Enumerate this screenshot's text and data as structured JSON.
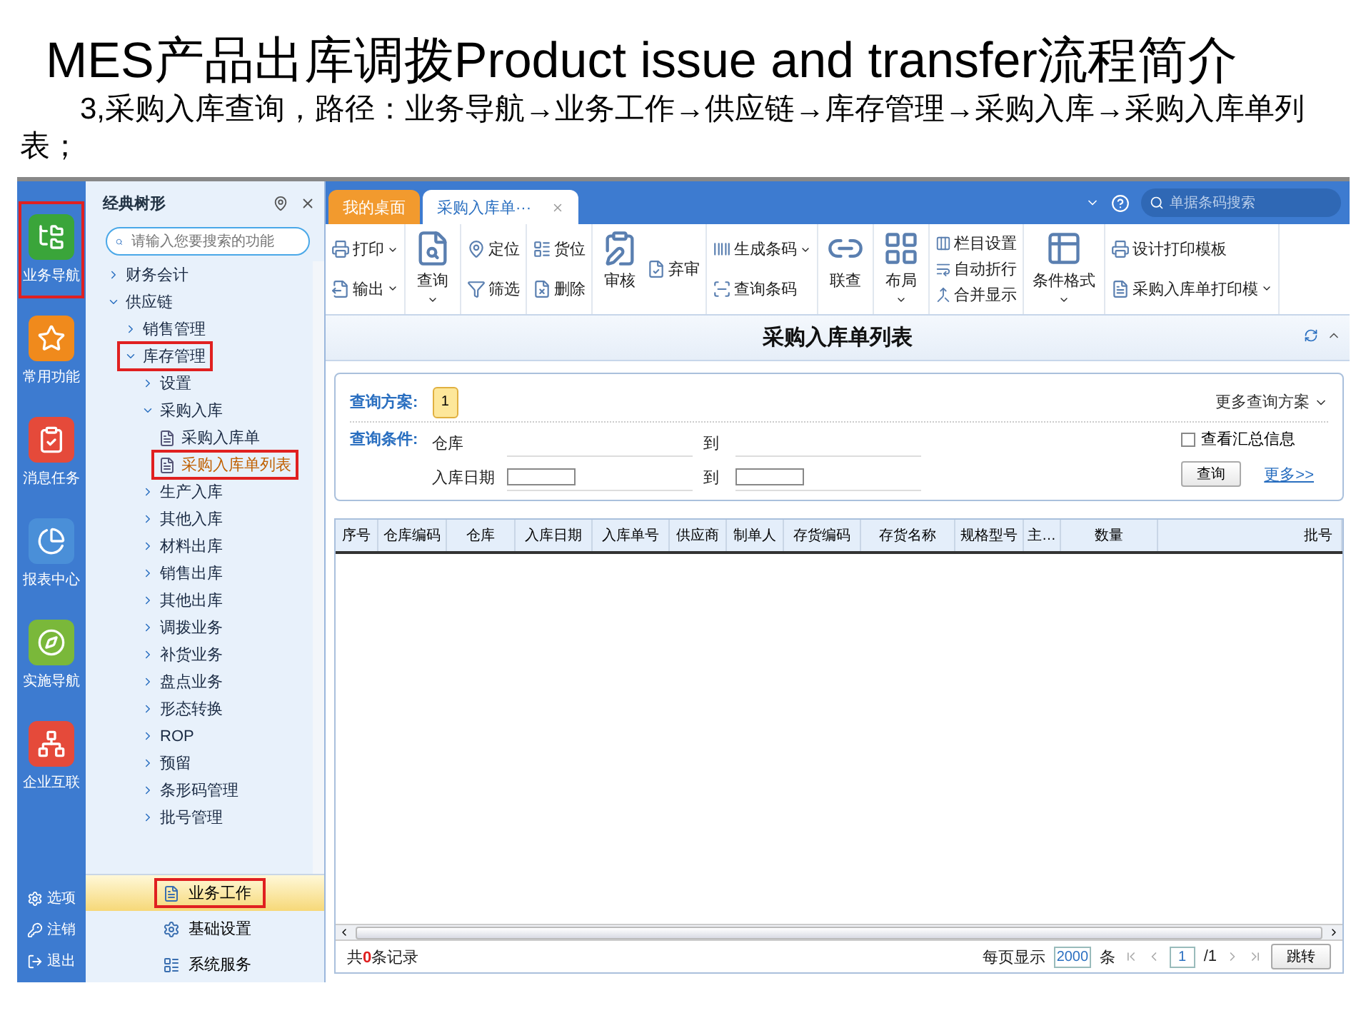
{
  "title": "MES产品出库调拨Product issue and transfer流程简介",
  "subtitle": "3,采购入库查询，路径：业务导航→业务工作→供应链→库存管理→采购入库→采购入库单列表；",
  "rail": {
    "items": [
      {
        "label": "业务导航",
        "kind": "nav",
        "highlighted": true
      },
      {
        "label": "常用功能",
        "kind": "star",
        "highlighted": false
      },
      {
        "label": "消息任务",
        "kind": "task",
        "highlighted": false
      },
      {
        "label": "报表中心",
        "kind": "report",
        "highlighted": false
      },
      {
        "label": "实施导航",
        "kind": "guide",
        "highlighted": false
      },
      {
        "label": "企业互联",
        "kind": "link",
        "highlighted": false
      }
    ],
    "bottom": [
      {
        "label": "选项",
        "kind": "gear"
      },
      {
        "label": "注销",
        "kind": "key"
      },
      {
        "label": "退出",
        "kind": "exit"
      }
    ]
  },
  "tree_panel": {
    "title": "经典树形",
    "search": {
      "placeholder": "请输入您要搜索的功能"
    },
    "tree": [
      {
        "label": "财务会计",
        "kind": "folder",
        "expanded": false,
        "highlighted": false,
        "selected": false
      },
      {
        "label": "供应链",
        "kind": "folder",
        "expanded": true,
        "highlighted": false,
        "selected": false,
        "children": [
          {
            "label": "销售管理",
            "kind": "folder",
            "expanded": false,
            "highlighted": false,
            "selected": false
          },
          {
            "label": "库存管理",
            "kind": "folder",
            "expanded": true,
            "highlighted": true,
            "selected": false,
            "children": [
              {
                "label": "设置",
                "kind": "folder",
                "expanded": false,
                "highlighted": false,
                "selected": false
              },
              {
                "label": "采购入库",
                "kind": "folder",
                "expanded": true,
                "highlighted": false,
                "selected": false,
                "children": [
                  {
                    "label": "采购入库单",
                    "kind": "doc",
                    "highlighted": false,
                    "selected": false
                  },
                  {
                    "label": "采购入库单列表",
                    "kind": "doc",
                    "highlighted": true,
                    "selected": true
                  }
                ]
              },
              {
                "label": "生产入库",
                "kind": "folder",
                "expanded": false,
                "highlighted": false,
                "selected": false
              },
              {
                "label": "其他入库",
                "kind": "folder",
                "expanded": false,
                "highlighted": false,
                "selected": false
              },
              {
                "label": "材料出库",
                "kind": "folder",
                "expanded": false,
                "highlighted": false,
                "selected": false
              },
              {
                "label": "销售出库",
                "kind": "folder",
                "expanded": false,
                "highlighted": false,
                "selected": false
              },
              {
                "label": "其他出库",
                "kind": "folder",
                "expanded": false,
                "highlighted": false,
                "selected": false
              },
              {
                "label": "调拨业务",
                "kind": "folder",
                "expanded": false,
                "highlighted": false,
                "selected": false
              },
              {
                "label": "补货业务",
                "kind": "folder",
                "expanded": false,
                "highlighted": false,
                "selected": false
              },
              {
                "label": "盘点业务",
                "kind": "folder",
                "expanded": false,
                "highlighted": false,
                "selected": false
              },
              {
                "label": "形态转换",
                "kind": "folder",
                "expanded": false,
                "highlighted": false,
                "selected": false
              },
              {
                "label": "ROP",
                "kind": "folder",
                "expanded": false,
                "highlighted": false,
                "selected": false
              },
              {
                "label": "预留",
                "kind": "folder",
                "expanded": false,
                "highlighted": false,
                "selected": false
              },
              {
                "label": "条形码管理",
                "kind": "folder",
                "expanded": false,
                "highlighted": false,
                "selected": false
              },
              {
                "label": "批号管理",
                "kind": "folder",
                "expanded": false,
                "highlighted": false,
                "selected": false
              }
            ]
          }
        ]
      }
    ],
    "sections": [
      {
        "label": "业务工作",
        "selected": true,
        "highlighted": true
      },
      {
        "label": "基础设置",
        "selected": false,
        "highlighted": false
      },
      {
        "label": "系统服务",
        "selected": false,
        "highlighted": false
      }
    ]
  },
  "tabs": [
    {
      "label": "我的桌面",
      "selected": false,
      "closable": false
    },
    {
      "label": "采购入库单···",
      "selected": true,
      "closable": true
    }
  ],
  "global_search": {
    "placeholder": "单据条码搜索"
  },
  "toolbar": [
    [
      {
        "label": "打印",
        "kind": "small",
        "dropdown": true
      },
      {
        "label": "输出",
        "kind": "small",
        "dropdown": true
      }
    ],
    [
      {
        "label": "查询",
        "kind": "big",
        "dropdown": true
      }
    ],
    [
      {
        "label": "定位",
        "kind": "small",
        "dropdown": false
      },
      {
        "label": "筛选",
        "kind": "small",
        "dropdown": false
      }
    ],
    [
      {
        "label": "货位",
        "kind": "small",
        "dropdown": false
      },
      {
        "label": "删除",
        "kind": "small",
        "dropdown": false
      }
    ],
    [
      {
        "label": "审核",
        "kind": "big",
        "dropdown": false
      },
      {
        "label": "弃审",
        "kind": "small",
        "dropdown": false
      }
    ],
    [
      {
        "label": "生成条码",
        "kind": "small",
        "dropdown": true
      },
      {
        "label": "查询条码",
        "kind": "small",
        "dropdown": false
      }
    ],
    [
      {
        "label": "联查",
        "kind": "big",
        "dropdown": false
      }
    ],
    [
      {
        "label": "布局",
        "kind": "big",
        "dropdown": true
      }
    ],
    [
      {
        "label": "栏目设置",
        "kind": "tiny",
        "dropdown": false
      },
      {
        "label": "自动折行",
        "kind": "tiny",
        "dropdown": false
      },
      {
        "label": "合并显示",
        "kind": "tiny",
        "dropdown": false
      }
    ],
    [
      {
        "label": "条件格式",
        "kind": "big",
        "dropdown": true
      }
    ],
    [
      {
        "label": "设计打印模板",
        "kind": "small",
        "dropdown": false
      },
      {
        "label": "采购入库单打印模",
        "kind": "small",
        "dropdown": true
      }
    ]
  ],
  "page_title": "采购入库单列表",
  "query": {
    "scheme_label": "查询方案:",
    "scheme_button": "1",
    "more_schemes": "更多查询方案",
    "condition_label": "查询条件:",
    "rows": [
      {
        "label": "仓库",
        "kind": "line",
        "to": "到"
      },
      {
        "label": "入库日期",
        "kind": "box",
        "to": "到"
      }
    ],
    "summary_checkbox": {
      "label": "查看汇总信息",
      "checked": false
    },
    "search_button": "查询",
    "more_link": "更多>>"
  },
  "grid": {
    "columns": [
      "序号",
      "仓库编码",
      "仓库",
      "入库日期",
      "入库单号",
      "供应商",
      "制单人",
      "存货编码",
      "存货名称",
      "规格型号",
      "主…",
      "数量",
      "批号"
    ]
  },
  "footer": {
    "count_prefix": "共",
    "count": "0",
    "count_suffix": "条记录",
    "per_page_label": "每页显示",
    "per_page": "2000",
    "per_page_unit": "条",
    "page": "1",
    "page_total": "/1",
    "jump_button": "跳转"
  }
}
